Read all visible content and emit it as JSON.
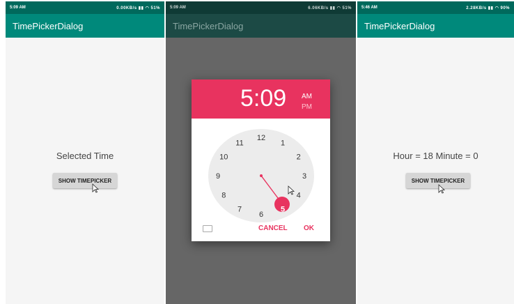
{
  "screens": [
    {
      "status": {
        "time": "5:09 AM",
        "speed": "0.00KB/s",
        "battery": "51%"
      },
      "title": "TimePickerDialog",
      "label": "Selected Time",
      "button": "SHOW TIMEPICKER"
    },
    {
      "status": {
        "time": "5:09 AM",
        "speed": "6.06KB/s",
        "battery": "51%"
      },
      "title": "TimePickerDialog",
      "dialog": {
        "hour": "5",
        "colon": ":",
        "minute": "09",
        "am": "AM",
        "pm": "PM",
        "numbers": [
          "12",
          "1",
          "2",
          "3",
          "4",
          "5",
          "6",
          "7",
          "8",
          "9",
          "10",
          "11"
        ],
        "selected_number": "5",
        "cancel": "CANCEL",
        "ok": "OK"
      }
    },
    {
      "status": {
        "time": "5:46 AM",
        "speed": "2.28KB/s",
        "battery": "90%"
      },
      "title": "TimePickerDialog",
      "label": "Hour = 18 Minute = 0",
      "button": "SHOW TIMEPICKER"
    }
  ],
  "colors": {
    "appbar": "#00897b",
    "accent": "#e8335f"
  },
  "icons": [
    "signal-icon",
    "wifi-icon",
    "battery-icon",
    "keyboard-icon",
    "cursor-icon"
  ]
}
